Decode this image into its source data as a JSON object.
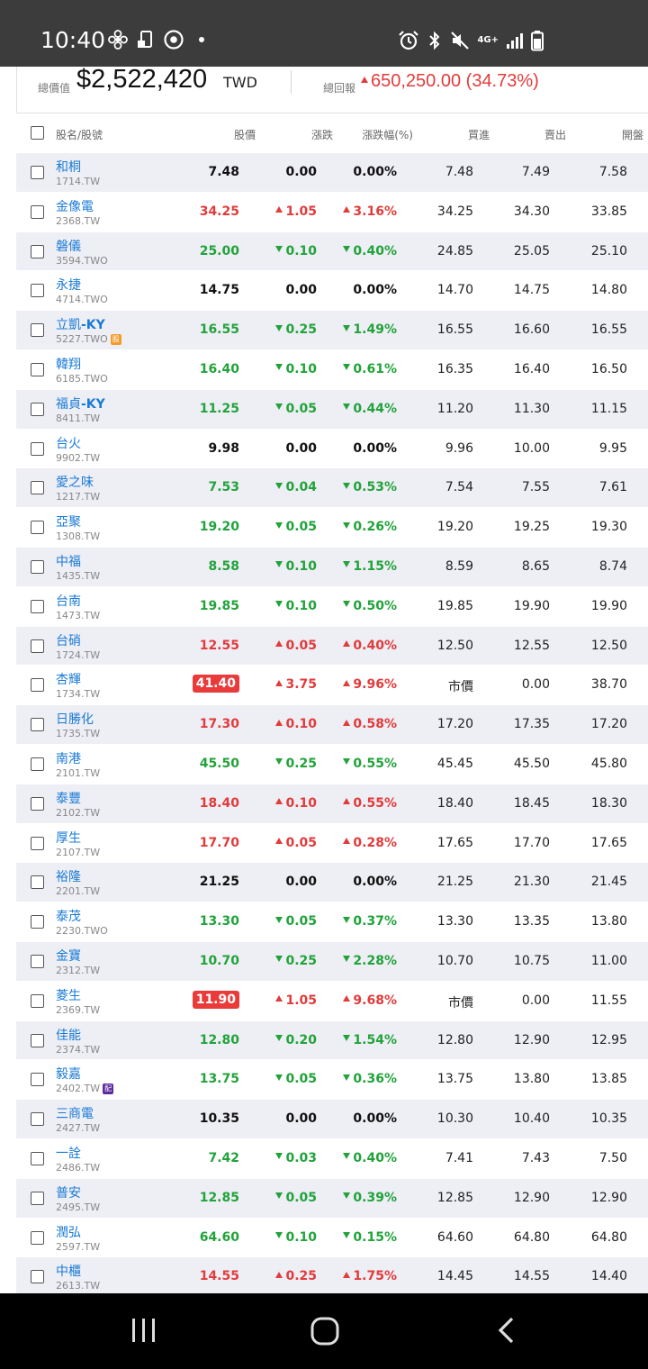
{
  "status_bar": {
    "time": "10:40",
    "network": "4G+"
  },
  "summary": {
    "total_value_label": "總價值",
    "total_value": "$2,522,420",
    "currency": "TWD",
    "total_return_label": "總回報",
    "total_return": "650,250.00 (34.73%)"
  },
  "table": {
    "headers": [
      "股名/股號",
      "股價",
      "漲跌",
      "漲跌幅(%)",
      "買進",
      "賣出",
      "開盤"
    ],
    "rows": [
      {
        "name": "和桐",
        "suffix": "",
        "code": "1714.TW",
        "badge": "",
        "price": "7.48",
        "change": "0.00",
        "pct": "0.00%",
        "dir": "flat",
        "boxed": false,
        "bid": "7.48",
        "ask": "7.49",
        "open": "7.58"
      },
      {
        "name": "金像電",
        "suffix": "",
        "code": "2368.TW",
        "badge": "",
        "price": "34.25",
        "change": "1.05",
        "pct": "3.16%",
        "dir": "up",
        "boxed": false,
        "bid": "34.25",
        "ask": "34.30",
        "open": "33.85"
      },
      {
        "name": "磐儀",
        "suffix": "",
        "code": "3594.TWO",
        "badge": "",
        "price": "25.00",
        "change": "0.10",
        "pct": "0.40%",
        "dir": "down",
        "boxed": false,
        "bid": "24.85",
        "ask": "25.05",
        "open": "25.10"
      },
      {
        "name": "永捷",
        "suffix": "",
        "code": "4714.TWO",
        "badge": "",
        "price": "14.75",
        "change": "0.00",
        "pct": "0.00%",
        "dir": "flat",
        "boxed": false,
        "bid": "14.70",
        "ask": "14.75",
        "open": "14.80"
      },
      {
        "name": "立凱",
        "suffix": "-KY",
        "code": "5227.TWO",
        "badge": "orange",
        "price": "16.55",
        "change": "0.25",
        "pct": "1.49%",
        "dir": "down",
        "boxed": false,
        "bid": "16.55",
        "ask": "16.60",
        "open": "16.55"
      },
      {
        "name": "韓翔",
        "suffix": "",
        "code": "6185.TWO",
        "badge": "",
        "price": "16.40",
        "change": "0.10",
        "pct": "0.61%",
        "dir": "down",
        "boxed": false,
        "bid": "16.35",
        "ask": "16.40",
        "open": "16.50"
      },
      {
        "name": "福貞",
        "suffix": "-KY",
        "code": "8411.TW",
        "badge": "",
        "price": "11.25",
        "change": "0.05",
        "pct": "0.44%",
        "dir": "down",
        "boxed": false,
        "bid": "11.20",
        "ask": "11.30",
        "open": "11.15"
      },
      {
        "name": "台火",
        "suffix": "",
        "code": "9902.TW",
        "badge": "",
        "price": "9.98",
        "change": "0.00",
        "pct": "0.00%",
        "dir": "flat",
        "boxed": false,
        "bid": "9.96",
        "ask": "10.00",
        "open": "9.95"
      },
      {
        "name": "愛之味",
        "suffix": "",
        "code": "1217.TW",
        "badge": "",
        "price": "7.53",
        "change": "0.04",
        "pct": "0.53%",
        "dir": "down",
        "boxed": false,
        "bid": "7.54",
        "ask": "7.55",
        "open": "7.61"
      },
      {
        "name": "亞聚",
        "suffix": "",
        "code": "1308.TW",
        "badge": "",
        "price": "19.20",
        "change": "0.05",
        "pct": "0.26%",
        "dir": "down",
        "boxed": false,
        "bid": "19.20",
        "ask": "19.25",
        "open": "19.30"
      },
      {
        "name": "中福",
        "suffix": "",
        "code": "1435.TW",
        "badge": "",
        "price": "8.58",
        "change": "0.10",
        "pct": "1.15%",
        "dir": "down",
        "boxed": false,
        "bid": "8.59",
        "ask": "8.65",
        "open": "8.74"
      },
      {
        "name": "台南",
        "suffix": "",
        "code": "1473.TW",
        "badge": "",
        "price": "19.85",
        "change": "0.10",
        "pct": "0.50%",
        "dir": "down",
        "boxed": false,
        "bid": "19.85",
        "ask": "19.90",
        "open": "19.90"
      },
      {
        "name": "台硝",
        "suffix": "",
        "code": "1724.TW",
        "badge": "",
        "price": "12.55",
        "change": "0.05",
        "pct": "0.40%",
        "dir": "up",
        "boxed": false,
        "bid": "12.50",
        "ask": "12.55",
        "open": "12.50"
      },
      {
        "name": "杏輝",
        "suffix": "",
        "code": "1734.TW",
        "badge": "",
        "price": "41.40",
        "change": "3.75",
        "pct": "9.96%",
        "dir": "up",
        "boxed": true,
        "bid": "市價",
        "ask": "0.00",
        "open": "38.70"
      },
      {
        "name": "日勝化",
        "suffix": "",
        "code": "1735.TW",
        "badge": "",
        "price": "17.30",
        "change": "0.10",
        "pct": "0.58%",
        "dir": "up",
        "boxed": false,
        "bid": "17.20",
        "ask": "17.35",
        "open": "17.20"
      },
      {
        "name": "南港",
        "suffix": "",
        "code": "2101.TW",
        "badge": "",
        "price": "45.50",
        "change": "0.25",
        "pct": "0.55%",
        "dir": "down",
        "boxed": false,
        "bid": "45.45",
        "ask": "45.50",
        "open": "45.80"
      },
      {
        "name": "泰豐",
        "suffix": "",
        "code": "2102.TW",
        "badge": "",
        "price": "18.40",
        "change": "0.10",
        "pct": "0.55%",
        "dir": "up",
        "boxed": false,
        "bid": "18.40",
        "ask": "18.45",
        "open": "18.30"
      },
      {
        "name": "厚生",
        "suffix": "",
        "code": "2107.TW",
        "badge": "",
        "price": "17.70",
        "change": "0.05",
        "pct": "0.28%",
        "dir": "up",
        "boxed": false,
        "bid": "17.65",
        "ask": "17.70",
        "open": "17.65"
      },
      {
        "name": "裕隆",
        "suffix": "",
        "code": "2201.TW",
        "badge": "",
        "price": "21.25",
        "change": "0.00",
        "pct": "0.00%",
        "dir": "flat",
        "boxed": false,
        "bid": "21.25",
        "ask": "21.30",
        "open": "21.45"
      },
      {
        "name": "泰茂",
        "suffix": "",
        "code": "2230.TWO",
        "badge": "",
        "price": "13.30",
        "change": "0.05",
        "pct": "0.37%",
        "dir": "down",
        "boxed": false,
        "bid": "13.30",
        "ask": "13.35",
        "open": "13.80"
      },
      {
        "name": "金寶",
        "suffix": "",
        "code": "2312.TW",
        "badge": "",
        "price": "10.70",
        "change": "0.25",
        "pct": "2.28%",
        "dir": "down",
        "boxed": false,
        "bid": "10.70",
        "ask": "10.75",
        "open": "11.00"
      },
      {
        "name": "菱生",
        "suffix": "",
        "code": "2369.TW",
        "badge": "",
        "price": "11.90",
        "change": "1.05",
        "pct": "9.68%",
        "dir": "up",
        "boxed": true,
        "bid": "市價",
        "ask": "0.00",
        "open": "11.55"
      },
      {
        "name": "佳能",
        "suffix": "",
        "code": "2374.TW",
        "badge": "",
        "price": "12.80",
        "change": "0.20",
        "pct": "1.54%",
        "dir": "down",
        "boxed": false,
        "bid": "12.80",
        "ask": "12.90",
        "open": "12.95"
      },
      {
        "name": "毅嘉",
        "suffix": "",
        "code": "2402.TW",
        "badge": "purple",
        "price": "13.75",
        "change": "0.05",
        "pct": "0.36%",
        "dir": "down",
        "boxed": false,
        "bid": "13.75",
        "ask": "13.80",
        "open": "13.85"
      },
      {
        "name": "三商電",
        "suffix": "",
        "code": "2427.TW",
        "badge": "",
        "price": "10.35",
        "change": "0.00",
        "pct": "0.00%",
        "dir": "flat",
        "boxed": false,
        "bid": "10.30",
        "ask": "10.40",
        "open": "10.35"
      },
      {
        "name": "一詮",
        "suffix": "",
        "code": "2486.TW",
        "badge": "",
        "price": "7.42",
        "change": "0.03",
        "pct": "0.40%",
        "dir": "down",
        "boxed": false,
        "bid": "7.41",
        "ask": "7.43",
        "open": "7.50"
      },
      {
        "name": "普安",
        "suffix": "",
        "code": "2495.TW",
        "badge": "",
        "price": "12.85",
        "change": "0.05",
        "pct": "0.39%",
        "dir": "down",
        "boxed": false,
        "bid": "12.85",
        "ask": "12.90",
        "open": "12.90"
      },
      {
        "name": "潤弘",
        "suffix": "",
        "code": "2597.TW",
        "badge": "",
        "price": "64.60",
        "change": "0.10",
        "pct": "0.15%",
        "dir": "down",
        "boxed": false,
        "bid": "64.60",
        "ask": "64.80",
        "open": "64.80"
      },
      {
        "name": "中櫃",
        "suffix": "",
        "code": "2613.TW",
        "badge": "",
        "price": "14.55",
        "change": "0.25",
        "pct": "1.75%",
        "dir": "up",
        "boxed": false,
        "bid": "14.45",
        "ask": "14.55",
        "open": "14.40"
      }
    ]
  },
  "colors": {
    "up": "#e23b3b",
    "down": "#21a33a",
    "link": "#1a7bd6",
    "row_alt": "#eeeef5"
  },
  "icons": {
    "status_left": [
      "fan-icon",
      "clipboard-icon",
      "chrome-icon",
      "dot-icon"
    ],
    "status_right": [
      "alarm-icon",
      "bluetooth-icon",
      "mute-icon",
      "signal-icon",
      "battery-icon"
    ],
    "nav": [
      "recent-apps-icon",
      "home-icon",
      "back-icon"
    ]
  }
}
